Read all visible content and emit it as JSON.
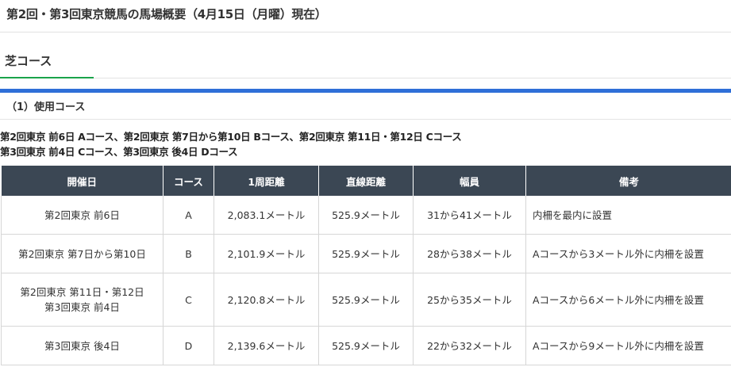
{
  "page_title": "第2回・第3回東京競馬の馬場概要（4月15日（月曜）現在）",
  "section_tab": "芝コース",
  "subheading": "（1）使用コース",
  "summary": {
    "line1": "第2回東京 前6日 Aコース、第2回東京 第7日から第10日 Bコース、第2回東京 第11日・第12日 Cコース",
    "line2": "第3回東京 前4日 Cコース、第3回東京 後4日 Dコース"
  },
  "table": {
    "headers": [
      "開催日",
      "コース",
      "1周距離",
      "直線距離",
      "幅員",
      "備考"
    ],
    "rows": [
      {
        "date_line1": "第2回東京 前6日",
        "date_line2": "",
        "course": "A",
        "lap": "2,083.1メートル",
        "straight": "525.9メートル",
        "width": "31から41メートル",
        "note": "内柵を最内に設置"
      },
      {
        "date_line1": "第2回東京 第7日から第10日",
        "date_line2": "",
        "course": "B",
        "lap": "2,101.9メートル",
        "straight": "525.9メートル",
        "width": "28から38メートル",
        "note": "Aコースから3メートル外に内柵を設置"
      },
      {
        "date_line1": "第2回東京 第11日・第12日",
        "date_line2": "第3回東京 前4日",
        "course": "C",
        "lap": "2,120.8メートル",
        "straight": "525.9メートル",
        "width": "25から35メートル",
        "note": "Aコースから6メートル外に内柵を設置"
      },
      {
        "date_line1": "第3回東京 後4日",
        "date_line2": "",
        "course": "D",
        "lap": "2,139.6メートル",
        "straight": "525.9メートル",
        "width": "22から32メートル",
        "note": "Aコースから9メートル外に内柵を設置"
      }
    ]
  },
  "colors": {
    "tab_underline": "#1aa34a",
    "blue_bar": "#2f6fd8",
    "table_header_bg": "#3b4754"
  }
}
